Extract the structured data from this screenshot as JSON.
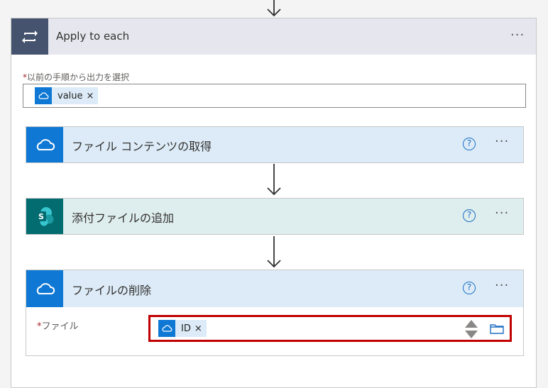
{
  "apply_each": {
    "title": "Apply to each",
    "more_label": "···",
    "select_label": "以前の手順から出力を選択",
    "required_mark": "*",
    "token": {
      "label": "value",
      "remove": "×"
    }
  },
  "steps": [
    {
      "title": "ファイル コンテンツの取得",
      "help": "?",
      "more": "···"
    },
    {
      "title": "添付ファイルの追加",
      "help": "?",
      "more": "···"
    },
    {
      "title": "ファイルの削除",
      "help": "?",
      "more": "···"
    }
  ],
  "delete_file": {
    "field_label": "ファイル",
    "required_mark": "*",
    "token": {
      "label": "ID",
      "remove": "×"
    }
  },
  "colors": {
    "onedrive_blue": "#0f78d4",
    "sharepoint_teal": "#038387",
    "loop_header": "#46536f",
    "highlight_red": "#c00000"
  }
}
